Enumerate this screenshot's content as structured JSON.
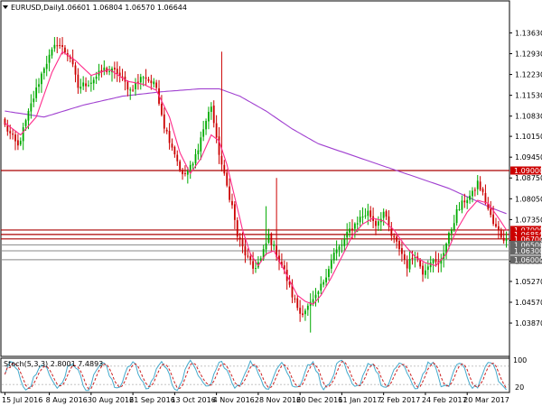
{
  "chart_data": {
    "type": "candlestick",
    "title": "EURUSD,Daily",
    "ohlc_text": "1.06601 1.06804 1.06570 1.06644",
    "colors": {
      "bull": "#00aa00",
      "bear": "#cc0000",
      "ma_fast": "#ff2a8a",
      "ma_slow": "#a040d0",
      "hline": "#aa0000",
      "hline_grey": "#888888",
      "stoch_main": "#44aacc",
      "stoch_signal": "#cc2222",
      "price_tag": "#cc0000",
      "price_tag_grey": "#666666"
    },
    "y_axis": {
      "min": 1.0284,
      "max": 1.1425,
      "ticks": [
        "1.13630",
        "1.12930",
        "1.12230",
        "1.11530",
        "1.10830",
        "1.10150",
        "1.09450",
        "1.08750",
        "1.08050",
        "1.07350",
        "1.06650",
        "1.05950",
        "1.05270",
        "1.04570",
        "1.03870"
      ]
    },
    "x_axis": {
      "labels": [
        "15 Jul 2016",
        "8 Aug 2016",
        "30 Aug 2016",
        "21 Sep 2016",
        "13 Oct 2016",
        "4 Nov 2016",
        "28 Nov 2016",
        "20 Dec 2016",
        "11 Jan 2017",
        "2 Feb 2017",
        "24 Feb 2017",
        "20 Mar 2017"
      ],
      "label_index": [
        0,
        17,
        33,
        49,
        65,
        81,
        97,
        113,
        129,
        145,
        161,
        177
      ]
    },
    "bar_count": 193,
    "close_path": [
      [
        0,
        1.105
      ],
      [
        5,
        1.098
      ],
      [
        10,
        1.112
      ],
      [
        15,
        1.125
      ],
      [
        20,
        1.133
      ],
      [
        25,
        1.128
      ],
      [
        28,
        1.118
      ],
      [
        33,
        1.12
      ],
      [
        38,
        1.124
      ],
      [
        43,
        1.123
      ],
      [
        48,
        1.117
      ],
      [
        53,
        1.122
      ],
      [
        58,
        1.118
      ],
      [
        61,
        1.105
      ],
      [
        65,
        1.096
      ],
      [
        68,
        1.088
      ],
      [
        72,
        1.092
      ],
      [
        76,
        1.104
      ],
      [
        79,
        1.112
      ],
      [
        81,
        1.1
      ],
      [
        84,
        1.088
      ],
      [
        87,
        1.078
      ],
      [
        89,
        1.068
      ],
      [
        92,
        1.062
      ],
      [
        95,
        1.057
      ],
      [
        98,
        1.06
      ],
      [
        101,
        1.068
      ],
      [
        104,
        1.062
      ],
      [
        107,
        1.056
      ],
      [
        110,
        1.048
      ],
      [
        113,
        1.042
      ],
      [
        116,
        1.044
      ],
      [
        119,
        1.047
      ],
      [
        122,
        1.053
      ],
      [
        126,
        1.062
      ],
      [
        129,
        1.065
      ],
      [
        132,
        1.07
      ],
      [
        136,
        1.074
      ],
      [
        139,
        1.076
      ],
      [
        142,
        1.072
      ],
      [
        145,
        1.076
      ],
      [
        148,
        1.068
      ],
      [
        151,
        1.064
      ],
      [
        154,
        1.058
      ],
      [
        157,
        1.062
      ],
      [
        160,
        1.056
      ],
      [
        163,
        1.06
      ],
      [
        166,
        1.058
      ],
      [
        170,
        1.068
      ],
      [
        173,
        1.076
      ],
      [
        176,
        1.08
      ],
      [
        179,
        1.082
      ],
      [
        181,
        1.086
      ],
      [
        183,
        1.082
      ],
      [
        185,
        1.077
      ],
      [
        187,
        1.072
      ],
      [
        190,
        1.068
      ],
      [
        192,
        1.0664
      ]
    ],
    "spikes": [
      {
        "bar": 83,
        "high": 1.13
      },
      {
        "bar": 104,
        "high": 1.0875
      },
      {
        "bar": 117,
        "low": 1.0355
      },
      {
        "bar": 100,
        "high": 1.078
      }
    ],
    "ma_fast": [
      [
        0,
        1.106
      ],
      [
        6,
        1.102
      ],
      [
        12,
        1.108
      ],
      [
        18,
        1.123
      ],
      [
        22,
        1.13
      ],
      [
        27,
        1.127
      ],
      [
        33,
        1.122
      ],
      [
        40,
        1.124
      ],
      [
        47,
        1.12
      ],
      [
        53,
        1.119
      ],
      [
        58,
        1.117
      ],
      [
        63,
        1.108
      ],
      [
        67,
        1.096
      ],
      [
        71,
        1.089
      ],
      [
        75,
        1.094
      ],
      [
        79,
        1.102
      ],
      [
        82,
        1.1
      ],
      [
        85,
        1.092
      ],
      [
        88,
        1.081
      ],
      [
        91,
        1.07
      ],
      [
        94,
        1.062
      ],
      [
        97,
        1.058
      ],
      [
        100,
        1.062
      ],
      [
        103,
        1.063
      ],
      [
        106,
        1.058
      ],
      [
        109,
        1.053
      ],
      [
        112,
        1.048
      ],
      [
        115,
        1.046
      ],
      [
        118,
        1.045
      ],
      [
        121,
        1.048
      ],
      [
        125,
        1.054
      ],
      [
        129,
        1.061
      ],
      [
        133,
        1.068
      ],
      [
        137,
        1.072
      ],
      [
        141,
        1.074
      ],
      [
        145,
        1.073
      ],
      [
        149,
        1.07
      ],
      [
        153,
        1.065
      ],
      [
        157,
        1.061
      ],
      [
        161,
        1.059
      ],
      [
        165,
        1.058
      ],
      [
        169,
        1.062
      ],
      [
        173,
        1.07
      ],
      [
        177,
        1.076
      ],
      [
        181,
        1.08
      ],
      [
        185,
        1.079
      ],
      [
        189,
        1.074
      ],
      [
        192,
        1.07
      ]
    ],
    "ma_slow": [
      [
        0,
        1.11
      ],
      [
        15,
        1.108
      ],
      [
        30,
        1.112
      ],
      [
        45,
        1.115
      ],
      [
        60,
        1.1165
      ],
      [
        75,
        1.1175
      ],
      [
        82,
        1.1175
      ],
      [
        90,
        1.115
      ],
      [
        100,
        1.11
      ],
      [
        110,
        1.104
      ],
      [
        120,
        1.099
      ],
      [
        130,
        1.096
      ],
      [
        140,
        1.093
      ],
      [
        150,
        1.09
      ],
      [
        160,
        1.087
      ],
      [
        170,
        1.084
      ],
      [
        180,
        1.08
      ],
      [
        186,
        1.0775
      ],
      [
        192,
        1.0755
      ]
    ],
    "horizontal_lines": [
      {
        "price": 1.09,
        "label": "1.09000",
        "style": "red"
      },
      {
        "price": 1.07,
        "label": "1.07000",
        "style": "red"
      },
      {
        "price": 1.0685,
        "label": "1.06850",
        "style": "red"
      },
      {
        "price": 1.067,
        "label": "1.06700",
        "style": "red"
      },
      {
        "price": 1.065,
        "label": "1.06500",
        "style": "grey"
      },
      {
        "price": 1.063,
        "label": "1.06300",
        "style": "grey"
      },
      {
        "price": 1.06,
        "label": "1.06000",
        "style": "grey"
      }
    ],
    "stochastic": {
      "label": "Stoch(5,3,3) 2.8001 7.4893",
      "main": 2.8001,
      "signal": 7.4893,
      "level_ticks": [
        "100",
        "20"
      ],
      "scale_top": "100",
      "scale_bottom": "20"
    }
  }
}
